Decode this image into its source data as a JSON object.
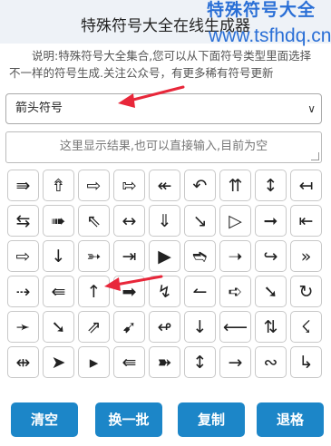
{
  "header": {
    "title": "特殊符号大全在线生成器"
  },
  "watermark": {
    "line1": "特殊符号大全",
    "line2": "www.tsfhdq.cn"
  },
  "description": "说明:特殊符号大全集合,您可以从下面符号类型里面选择不一样的符号生成.关注公众号，有更多稀有符号更新",
  "selector": {
    "value": "箭头符号"
  },
  "result": {
    "placeholder": "这里显示结果,也可以直接输入,目前为空"
  },
  "symbols": [
    "⇛",
    "⇮",
    "⇨",
    "⇰",
    "↞",
    "↶",
    "⇈",
    "↕",
    "↤",
    "⇆",
    "➠",
    "⇖",
    "↔",
    "⇓",
    "↘",
    "▷",
    "➞",
    "⇤",
    "⇨",
    "↓",
    "➳",
    "⇥",
    "▶",
    "➬",
    "➝",
    "↪",
    "»",
    "⇢",
    "⇚",
    "↑",
    "➡",
    "↯",
    "↼",
    "➪",
    "➘",
    "↻",
    "➛",
    "➘",
    "⇗",
    "➹",
    "↫",
    "↓",
    "⟵",
    "⇅",
    "☇",
    "⇹",
    "➤",
    "▸",
    "⇚",
    "➽",
    "↕",
    "→",
    "∾",
    "↳"
  ],
  "buttons": {
    "clear": "清空",
    "shuffle": "换一批",
    "copy": "复制",
    "backspace": "退格"
  },
  "colors": {
    "button": "#1c86c8",
    "watermark": "#2a6fd6",
    "annotation_arrow": "#e8273a"
  }
}
